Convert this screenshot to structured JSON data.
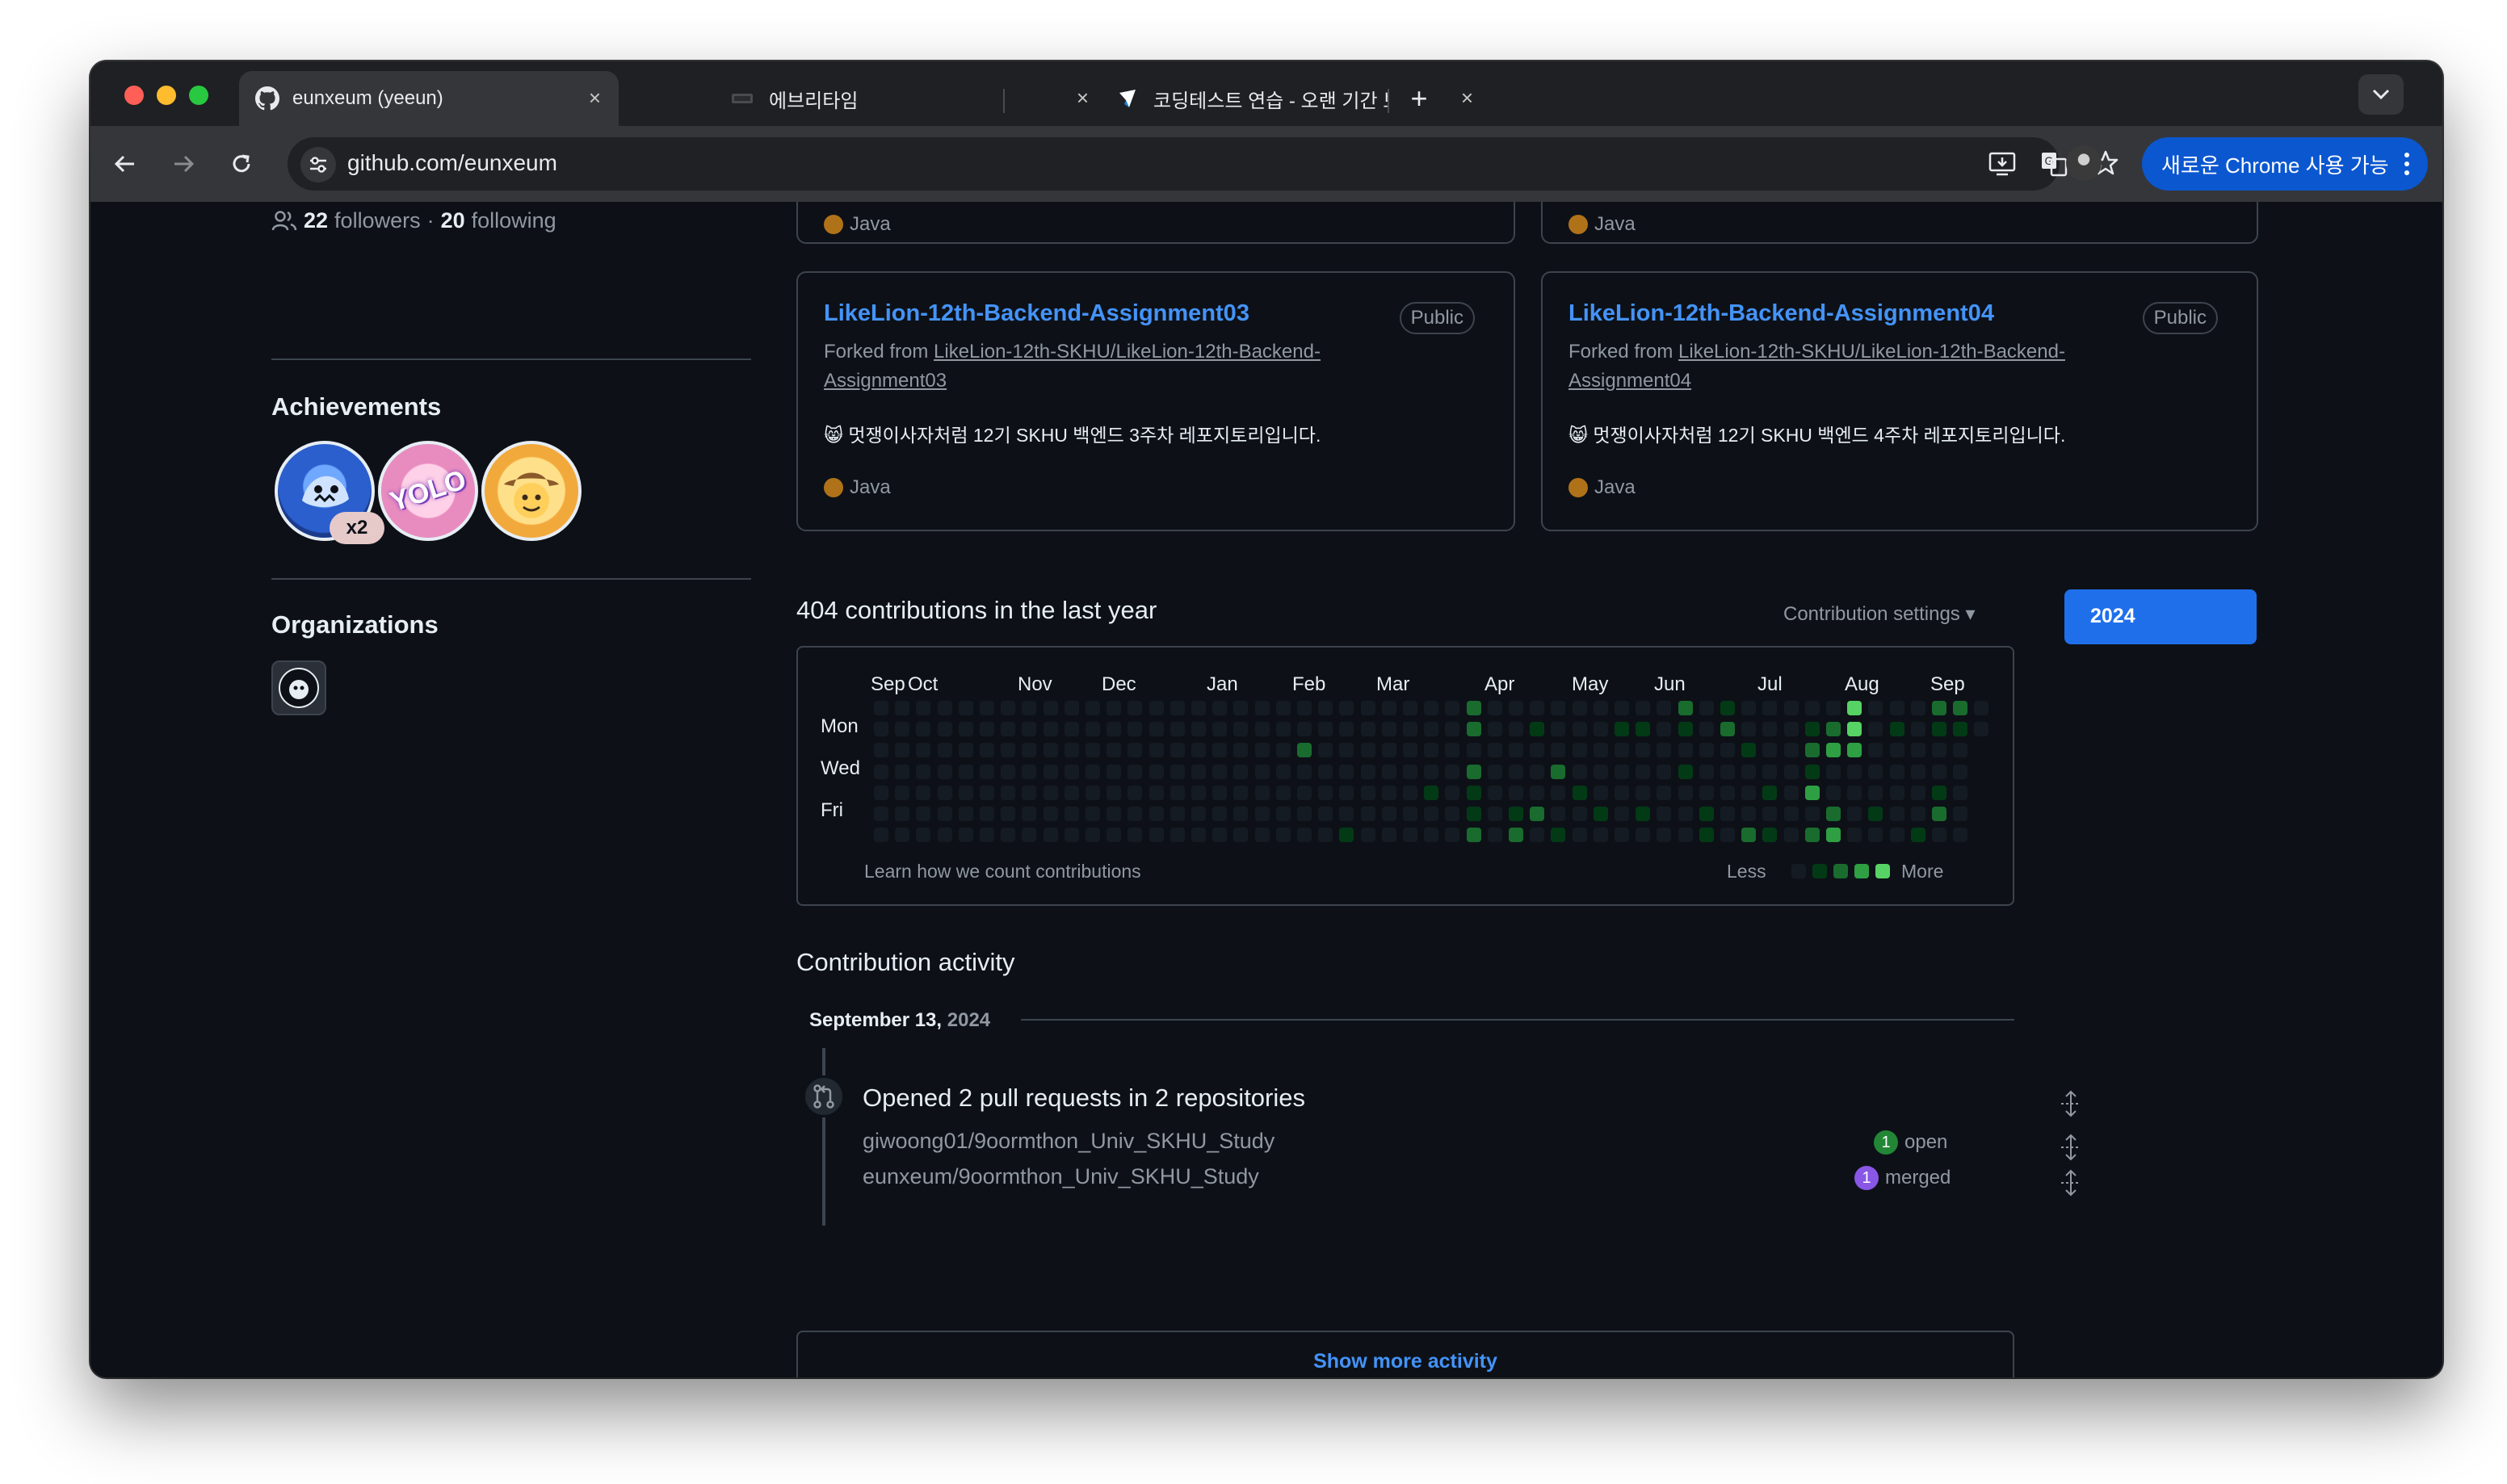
{
  "browser": {
    "tabs": [
      {
        "title": "eunxeum (yeeun)",
        "icon": "github-icon",
        "active": true
      },
      {
        "title": "에브리타임",
        "icon": "everytime-icon",
        "active": false
      },
      {
        "title": "코딩테스트 연습 - 오랜 기간 보호한",
        "icon": "programmers-icon",
        "active": false
      }
    ],
    "new_tab": "+",
    "close": "×",
    "url": "github.com/eunxeum",
    "chrome_update": "새로운 Chrome 사용 가능"
  },
  "sidebar": {
    "followers_count": "22",
    "followers_label": "followers",
    "sep": "·",
    "following_count": "20",
    "following_label": "following",
    "achievements_heading": "Achievements",
    "achievement_multiplier": "x2",
    "achievement_badge_text": "YOLO",
    "organizations_heading": "Organizations"
  },
  "repos": [
    {
      "name": "LikeLion-12th-Backend-Assignment03",
      "visibility": "Public",
      "forked_prefix": "Forked from ",
      "forked_from": "LikeLion-12th-SKHU/LikeLion-12th-Backend-Assignment03",
      "description": "😸 멋쟁이사자처럼 12기 SKHU 백엔드 3주차 레포지토리입니다.",
      "language": "Java"
    },
    {
      "name": "LikeLion-12th-Backend-Assignment04",
      "visibility": "Public",
      "forked_prefix": "Forked from ",
      "forked_from": "LikeLion-12th-SKHU/LikeLion-12th-Backend-Assignment04",
      "description": "😸 멋쟁이사자처럼 12기 SKHU 백엔드 4주차 레포지토리입니다.",
      "language": "Java"
    }
  ],
  "partial_language_above": "Java",
  "contributions": {
    "heading": "404 contributions in the last year",
    "settings_label": "Contribution settings ▾",
    "year_selected": "2024",
    "months": [
      "Sep",
      "Oct",
      "Nov",
      "Dec",
      "Jan",
      "Feb",
      "Mar",
      "Apr",
      "May",
      "Jun",
      "Jul",
      "Aug",
      "Sep"
    ],
    "days": [
      "Mon",
      "Wed",
      "Fri"
    ],
    "learn_link": "Learn how we count contributions",
    "legend_less": "Less",
    "legend_more": "More",
    "level_colors": [
      "#151b23",
      "#033a16",
      "#196c2e",
      "#2ea043",
      "#56d364"
    ]
  },
  "activity": {
    "heading": "Contribution activity",
    "month": "September 13,",
    "year": "2024",
    "pr_summary": "Opened 2 pull requests in 2 repositories",
    "items": [
      {
        "repo": "giwoong01/9oormthon_Univ_SKHU_Study",
        "count": "1",
        "state": "open",
        "color": "#238636"
      },
      {
        "repo": "eunxeum/9oormthon_Univ_SKHU_Study",
        "count": "1",
        "state": "merged",
        "color": "#8957e5"
      }
    ],
    "show_more": "Show more activity"
  }
}
